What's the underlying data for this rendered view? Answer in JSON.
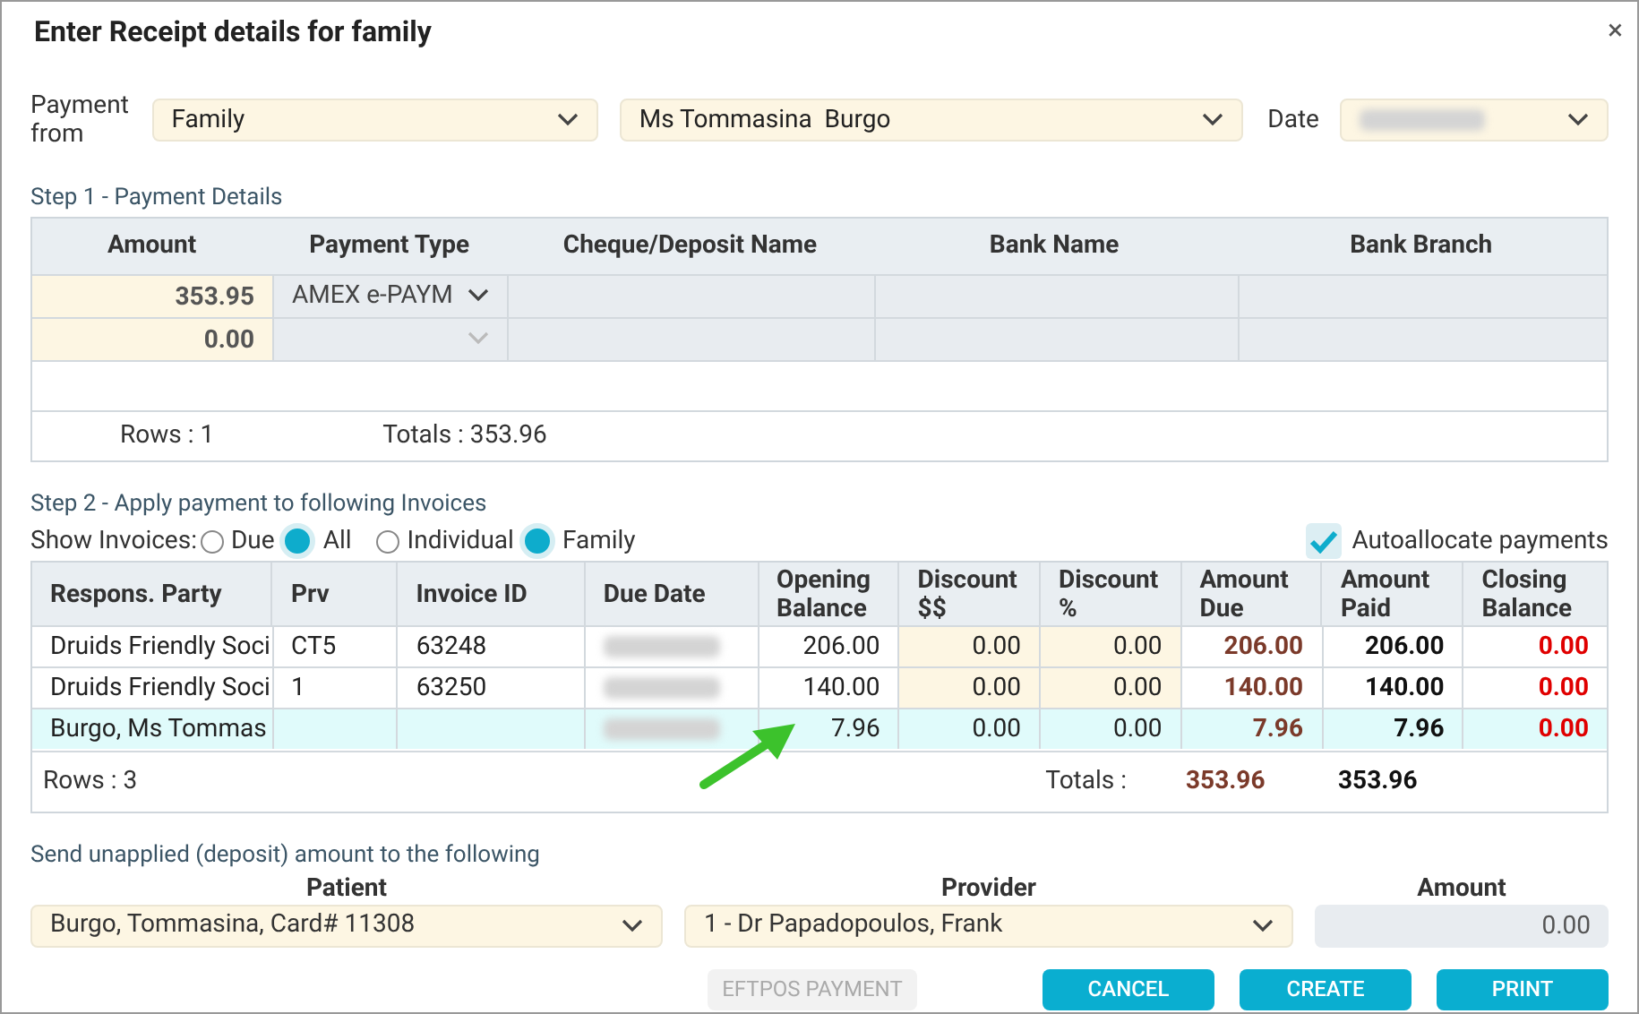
{
  "window": {
    "title": "Enter Receipt details for family",
    "close": "×"
  },
  "payment_from": {
    "label": "Payment from",
    "type_value": "Family",
    "person_value": "Ms Tommasina  Burgo",
    "date_label": "Date"
  },
  "step1": {
    "title": "Step 1 - Payment Details",
    "columns": [
      "Amount",
      "Payment Type",
      "Cheque/Deposit Name",
      "Bank Name",
      "Bank Branch"
    ],
    "rows": [
      {
        "amount": "353.95",
        "payment_type": "AMEX e-PAYM"
      },
      {
        "amount": "0.00"
      }
    ],
    "footer": {
      "rows": "Rows : 1",
      "totals": "Totals : 353.96"
    }
  },
  "step2": {
    "title": "Step 2 - Apply payment to following Invoices",
    "show_label": "Show Invoices:",
    "filters": [
      {
        "label": "Due",
        "selected": false
      },
      {
        "label": "All",
        "selected": true
      },
      {
        "label": "Individual",
        "selected": false
      },
      {
        "label": "Family",
        "selected": true
      }
    ],
    "autoallocate": {
      "label": "Autoallocate payments",
      "checked": true
    },
    "columns": [
      {
        "label": "Respons. Party",
        "kind": "text"
      },
      {
        "label": "Prv",
        "kind": "text"
      },
      {
        "label": "Invoice ID",
        "kind": "text"
      },
      {
        "label": "Due Date",
        "kind": "blurred"
      },
      {
        "label": "Opening Balance",
        "kind": "number"
      },
      {
        "label": "Discount $$",
        "kind": "editable"
      },
      {
        "label": "Discount %",
        "kind": "editable"
      },
      {
        "label": "Amount Due",
        "kind": "due"
      },
      {
        "label": "Amount Paid",
        "kind": "paid"
      },
      {
        "label": "Closing Balance",
        "kind": "closing"
      }
    ],
    "rows": [
      {
        "selected": false,
        "cells": [
          "Druids Friendly Soci",
          "CT5",
          "63248",
          null,
          "206.00",
          "0.00",
          "0.00",
          "206.00",
          "206.00",
          "0.00"
        ]
      },
      {
        "selected": false,
        "cells": [
          "Druids Friendly Soci",
          "1",
          "63250",
          null,
          "140.00",
          "0.00",
          "0.00",
          "140.00",
          "140.00",
          "0.00"
        ]
      },
      {
        "selected": true,
        "cells": [
          "Burgo, Ms Tommas",
          null,
          null,
          null,
          "7.96",
          "0.00",
          "0.00",
          "7.96",
          "7.96",
          "0.00"
        ]
      }
    ],
    "footer": {
      "rows": "Rows : 3",
      "totals_label": "Totals :",
      "total_due": "353.96",
      "total_paid": "353.96"
    }
  },
  "deposit": {
    "title": "Send unapplied (deposit) amount to the following",
    "patient_label": "Patient",
    "patient_value": "Burgo, Tommasina, Card# 11308",
    "provider_label": "Provider",
    "provider_value": "1 - Dr Papadopoulos, Frank",
    "amount_label": "Amount",
    "amount_value": "0.00"
  },
  "buttons": [
    {
      "label": "EFTPOS PAYMENT",
      "disabled": true
    },
    {
      "label": "CANCEL",
      "disabled": false
    },
    {
      "label": "CREATE",
      "disabled": false
    },
    {
      "label": "PRINT",
      "disabled": false
    }
  ]
}
